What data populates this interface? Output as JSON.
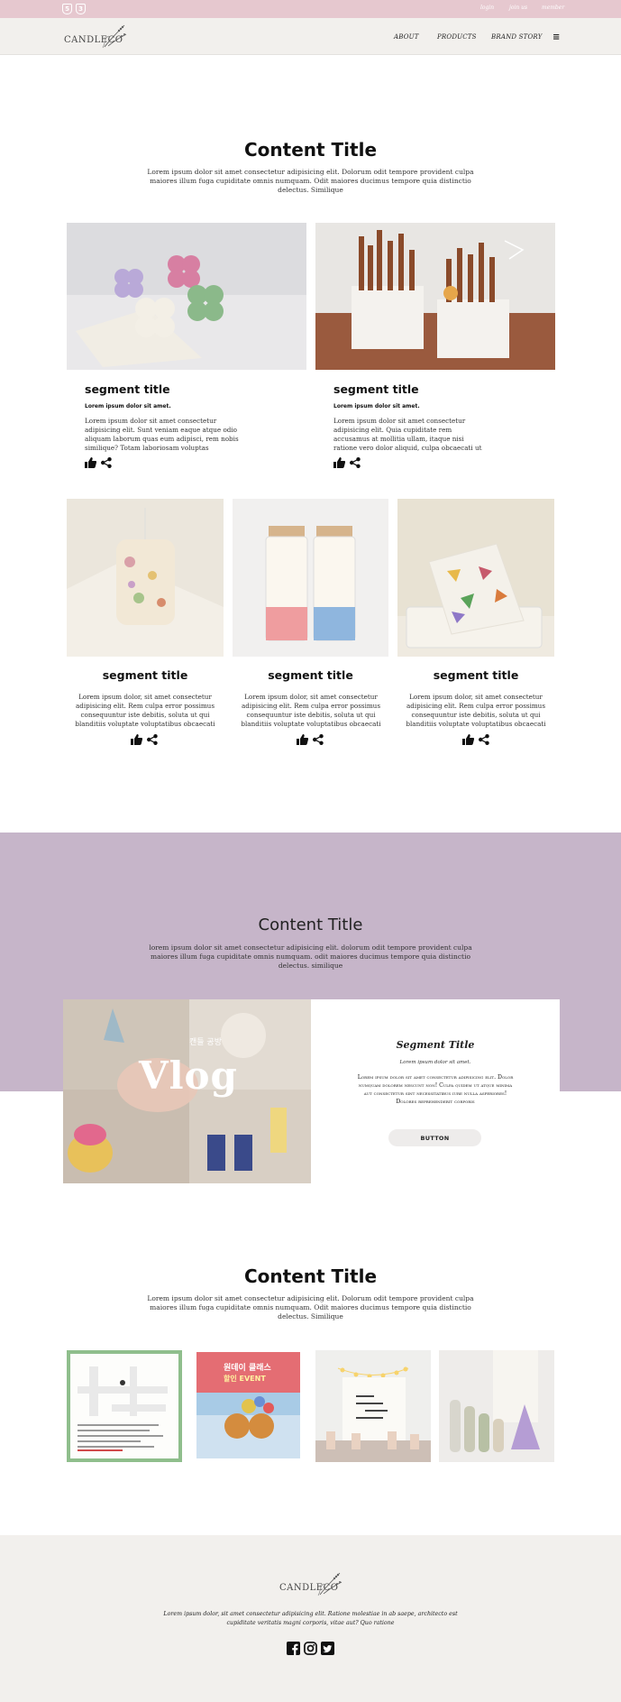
{
  "topbar": {
    "links": [
      "login",
      "join us",
      "member"
    ]
  },
  "header": {
    "logo": "CANDLECO",
    "nav": [
      "ABOUT",
      "PRODUCTS",
      "BRAND STORY"
    ],
    "menu_icon": "≡"
  },
  "section1": {
    "title": "Content Title",
    "desc": "Lorem ipsum dolor sit amet consectetur adipisicing elit. Dolorum odit tempore provident culpa maiores illum fuga cupiditate omnis numquam. Odit maiores ducimus tempore quia distinctio delectus. Similique",
    "large_cards": [
      {
        "title": "segment title",
        "subtitle": "Lorem ipsum dolor sit amet.",
        "body": "Lorem ipsum dolor sit amet consectetur adipisicing elit. Sunt veniam eaque atque odio aliquam laborum quas eum adipisci, rem nobis similique? Totam laboriosam voluptas"
      },
      {
        "title": "segment title",
        "subtitle": "Lorem ipsum dolor sit amet.",
        "body": "Lorem ipsum dolor sit amet consectetur adipisicing elit. Quia cupiditate rem accusamus at mollitia ullam, itaque nisi ratione vero dolor aliquid, culpa obcaecati ut"
      }
    ],
    "small_cards": [
      {
        "title": "segment title",
        "body": "Lorem ipsum dolor, sit amet consectetur adipisicing elit. Rem culpa error possimus consequuntur iste debitis, soluta ut qui blanditiis voluptate voluptatibus obcaecati"
      },
      {
        "title": "segment title",
        "body": "Lorem ipsum dolor, sit amet consectetur adipisicing elit. Rem culpa error possimus consequuntur iste debitis, soluta ut qui blanditiis voluptate voluptatibus obcaecati"
      },
      {
        "title": "segment title",
        "body": "Lorem ipsum dolor, sit amet consectetur adipisicing elit. Rem culpa error possimus consequuntur iste debitis, soluta ut qui blanditiis voluptate voluptatibus obcaecati"
      }
    ]
  },
  "section2": {
    "title": "Content Title",
    "desc": "lorem ipsum dolor sit amet consectetur adipisicing elit. dolorum odit tempore provident culpa maiores illum fuga cupiditate omnis numquam. odit maiores ducimus tempore quia distinctio delectus. similique",
    "vlog_label": "Vlog",
    "vlog_korean": "캔들 공방",
    "card": {
      "title": "Segment Title",
      "subtitle": "Lorem ipsum dolor sit amet.",
      "body": "Lorem ipsum dolor sit amet consectetur adipisicing elit. Dolor numquam dolorem nescunt non! Culpa quidem ut atque minima aut consectetur sint necessitatibus iure nulla asperiores! Dolores reprehenderit corporis",
      "button": "BUTTON"
    }
  },
  "section3": {
    "title": "Content Title",
    "desc": "Lorem ipsum dolor sit amet consectetur adipisicing elit. Dolorum odit tempore provident culpa maiores illum fuga cupiditate omnis numquam. Odit maiores ducimus tempore quia distinctio delectus. Similique",
    "poster_korean_top": "원데이 클래스",
    "poster_event": "할인 EVENT"
  },
  "footer": {
    "logo": "CANDLECO",
    "desc": "Lorem ipsum dolor, sit amet consectetur adipisicing elit. Ratione molestiae in ab saepe, architecto est cupiditate veritatis magni corporis, vitae aut? Quo ratione"
  },
  "colors": {
    "topbar": "#e6c8cf",
    "header": "#f2f0ed",
    "purple": "#c6b5c9",
    "footer": "#f2f0ed"
  }
}
